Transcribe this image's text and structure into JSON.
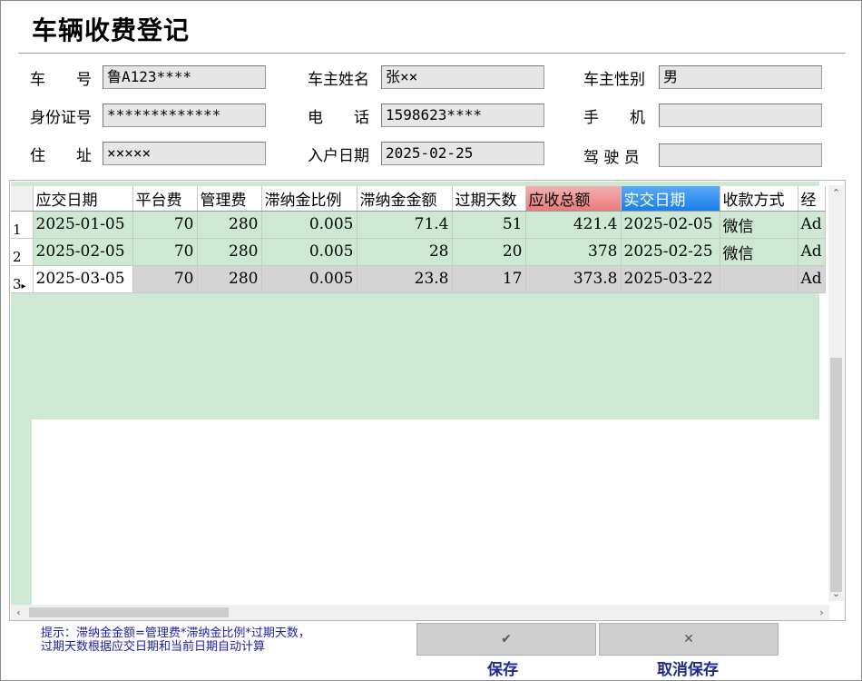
{
  "title": "车辆收费登记",
  "fields": [
    {
      "key": "plate",
      "label": "车　　号",
      "value": "鲁A123****"
    },
    {
      "key": "owner_name",
      "label": "车主姓名",
      "value": "张××"
    },
    {
      "key": "owner_gender",
      "label": "车主性别",
      "value": "男"
    },
    {
      "key": "id_no",
      "label": "身份证号",
      "value": "*************"
    },
    {
      "key": "phone",
      "label": "电　　话",
      "value": "1598623****"
    },
    {
      "key": "mobile",
      "label": "手　　机",
      "value": ""
    },
    {
      "key": "address",
      "label": "住　　址",
      "value": "×××××"
    },
    {
      "key": "join_date",
      "label": "入户日期",
      "value": "2025-02-25"
    },
    {
      "key": "driver",
      "label": "驾 驶 员",
      "value": ""
    }
  ],
  "grid": {
    "columns": [
      "应交日期",
      "平台费",
      "管理费",
      "滞纳金比例",
      "滞纳金金额",
      "过期天数",
      "应收总额",
      "实交日期",
      "收款方式",
      "经"
    ],
    "rows": [
      {
        "rh": "1",
        "cells": [
          "2025-01-05",
          "70",
          "280",
          "0.005",
          "71.4",
          "51",
          "421.4",
          "2025-02-05",
          "微信",
          "Ad"
        ]
      },
      {
        "rh": "2",
        "cells": [
          "2025-02-05",
          "70",
          "280",
          "0.005",
          "28",
          "20",
          "378",
          "2025-02-25",
          "微信",
          "Ad"
        ]
      },
      {
        "rh": "3",
        "cells": [
          "2025-03-05",
          "70",
          "280",
          "0.005",
          "23.8",
          "17",
          "373.8",
          "2025-03-22",
          "",
          "Ad"
        ]
      }
    ],
    "selected_row_marker": "▸"
  },
  "hint_lines": [
    "提示：滞纳金金额=管理费*滞纳金比例*过期天数，",
    "过期天数根据应交日期和当前日期自动计算"
  ],
  "buttons": {
    "save_icon": "✔",
    "cancel_icon": "✕",
    "save_label": "保存",
    "cancel_label": "取消保存"
  },
  "colors": {
    "grid_green": "#cde8d3",
    "header_pink": "#e87c7c",
    "header_blue": "#1a7ee8",
    "hint_blue": "#1e22a8",
    "button_label_blue": "#1e2a8c"
  }
}
